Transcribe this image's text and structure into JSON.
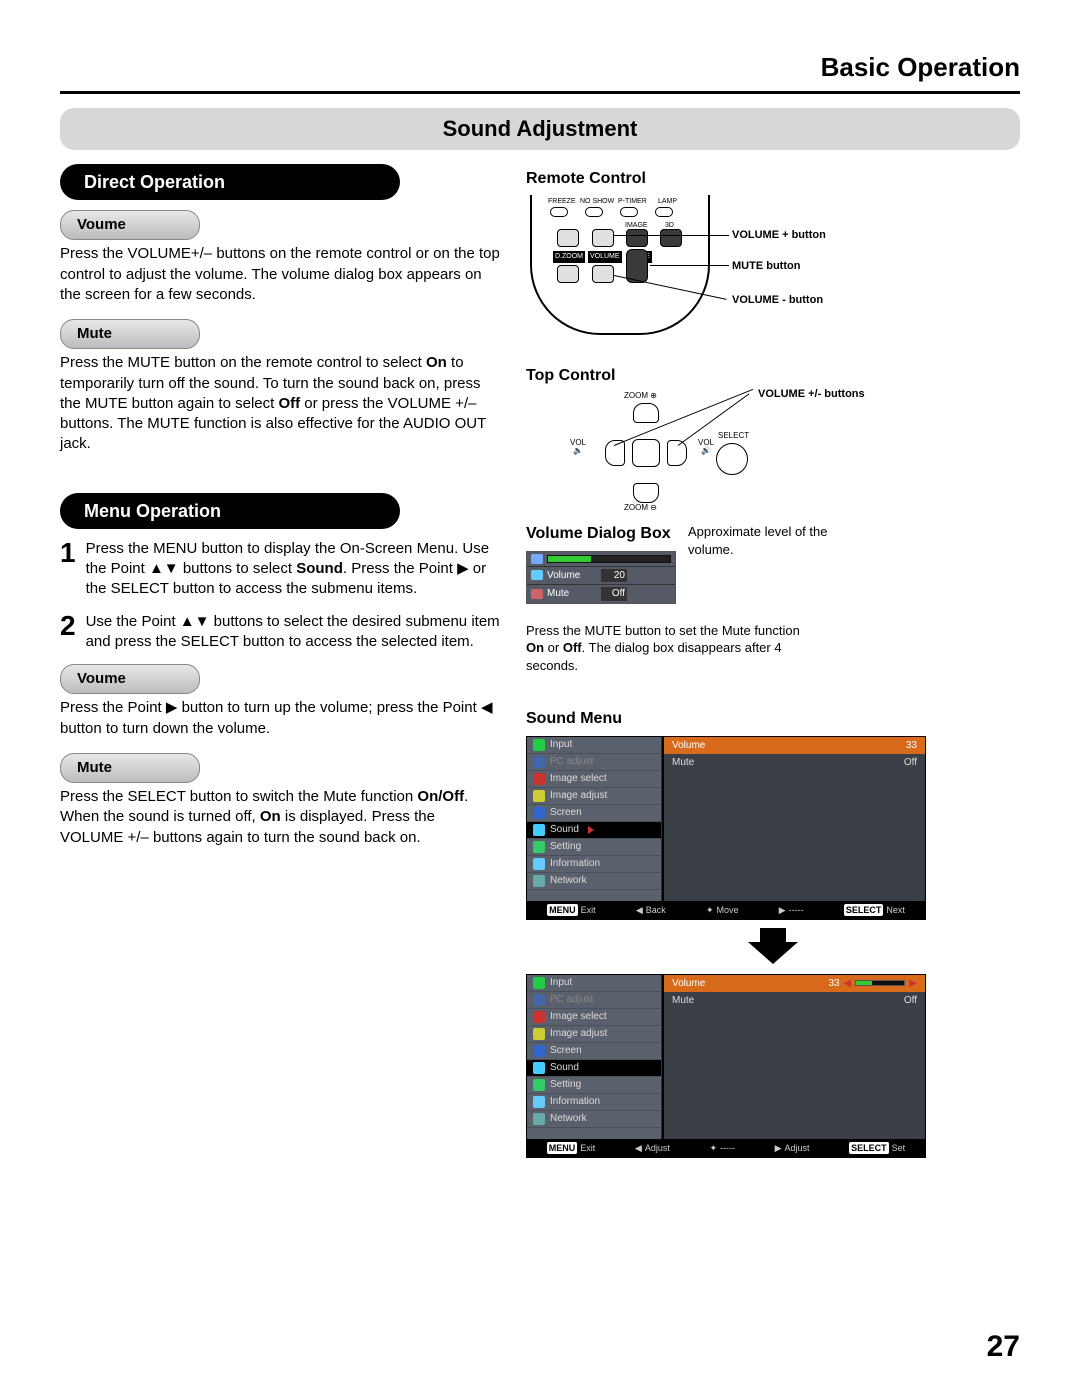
{
  "header": {
    "title": "Basic Operation"
  },
  "section": {
    "bar": "Sound Adjustment"
  },
  "left": {
    "direct_op": "Direct Operation",
    "volume_pill": "Voume",
    "volume_text": "Press the VOLUME+/– buttons on the remote control or on the top control to adjust the volume. The volume dialog box appears on the screen for a few seconds.",
    "mute_pill": "Mute",
    "mute_text_a": "Press the MUTE button on the remote control to select ",
    "mute_on": "On",
    "mute_text_b": " to temporarily turn off the sound. To turn the sound back on, press the MUTE button again to select ",
    "mute_off": "Off",
    "mute_text_c": " or press the VOLUME +/– buttons. The MUTE function is also effective for the AUDIO OUT jack.",
    "menu_op": "Menu Operation",
    "step1": "Press the MENU button to display the On-Screen Menu. Use the Point ▲▼ buttons to select ",
    "step1_sound": "Sound",
    "step1b": ". Press the Point ▶ or the SELECT button to access the submenu items.",
    "step2": "Use the Point ▲▼ buttons to select the desired submenu item and press the SELECT button to access the selected item.",
    "volume2_pill": "Voume",
    "volume2_text": "Press the Point ▶ button to turn up the volume; press the Point ◀ button to turn down the volume.",
    "mute2_pill": "Mute",
    "mute2_text_a": "Press the SELECT button to switch the Mute function ",
    "mute2_onoff": "On/Off",
    "mute2_text_b": ". When the sound is turned off, ",
    "mute2_on": "On",
    "mute2_text_c": " is displayed. Press the VOLUME +/– buttons again to turn the sound back on."
  },
  "right": {
    "remote_h": "Remote Control",
    "remote_labels": {
      "freeze": "FREEZE",
      "noshow": "NO SHOW",
      "ptimer": "P-TIMER",
      "lamp": "LAMP",
      "image": "IMAGE",
      "threeD": "3D",
      "dzoom": "D.ZOOM",
      "volume": "VOLUME",
      "mute": "MUTE"
    },
    "callouts": {
      "volplus": "VOLUME + button",
      "mute": "MUTE button",
      "volminus": "VOLUME - button"
    },
    "top_h": "Top Control",
    "top_labels": {
      "zoomp": "ZOOM ⊕",
      "zoomm": "ZOOM ⊖",
      "voll": "VOL",
      "volr": "VOL",
      "select": "SELECT"
    },
    "top_callout": "VOLUME +/- buttons",
    "vdlg_h": "Volume Dialog Box",
    "vdlg_volume": "Volume",
    "vdlg_volume_val": "20",
    "vdlg_mute": "Mute",
    "vdlg_mute_val": "Off",
    "vdlg_note": "Approximate level of the volume.",
    "vdlg_caption_a": "Press the MUTE button to set the Mute function ",
    "vdlg_caption_on": "On",
    "vdlg_caption_or": " or ",
    "vdlg_caption_off": "Off",
    "vdlg_caption_b": ". The dialog box disappears after 4 seconds.",
    "sound_menu_h": "Sound Menu",
    "osd_side": [
      "Input",
      "PC adjust",
      "Image select",
      "Image adjust",
      "Screen",
      "Sound",
      "Setting",
      "Information",
      "Network"
    ],
    "osd_volume": "Volume",
    "osd_volume_val": "33",
    "osd_mute": "Mute",
    "osd_mute_val": "Off",
    "osd_footer1": {
      "exit": "Exit",
      "back": "Back",
      "move": "Move",
      "dash": "-----",
      "next": "Next"
    },
    "osd_footer2": {
      "exit": "Exit",
      "adjust": "Adjust",
      "dash": "-----",
      "adjust2": "Adjust",
      "set": "Set"
    },
    "osd_menu_tag": "MENU",
    "osd_select_tag": "SELECT"
  },
  "page": "27"
}
